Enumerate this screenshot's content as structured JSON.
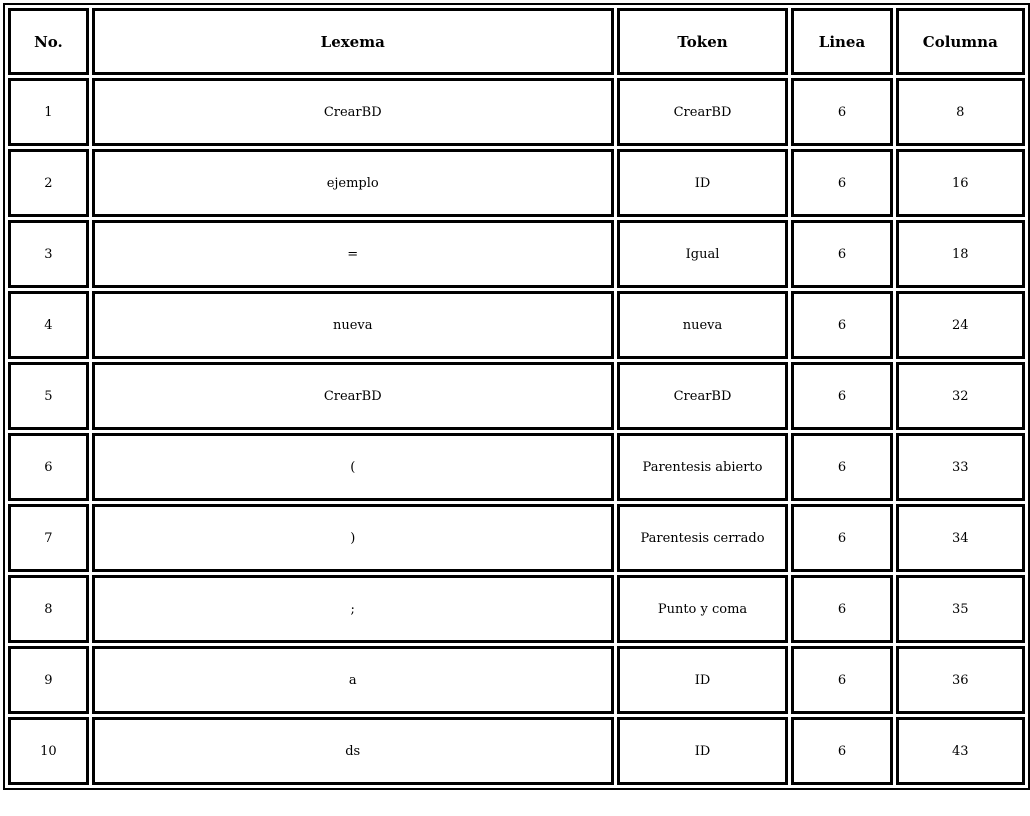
{
  "table": {
    "headers": {
      "no": "No.",
      "lexema": "Lexema",
      "token": "Token",
      "linea": "Linea",
      "columna": "Columna"
    },
    "rows": [
      {
        "no": "1",
        "lexema": "CrearBD",
        "token": "CrearBD",
        "linea": "6",
        "columna": "8"
      },
      {
        "no": "2",
        "lexema": "ejemplo",
        "token": "ID",
        "linea": "6",
        "columna": "16"
      },
      {
        "no": "3",
        "lexema": "=",
        "token": "Igual",
        "linea": "6",
        "columna": "18"
      },
      {
        "no": "4",
        "lexema": "nueva",
        "token": "nueva",
        "linea": "6",
        "columna": "24"
      },
      {
        "no": "5",
        "lexema": "CrearBD",
        "token": "CrearBD",
        "linea": "6",
        "columna": "32"
      },
      {
        "no": "6",
        "lexema": "(",
        "token": "Parentesis abierto",
        "linea": "6",
        "columna": "33"
      },
      {
        "no": "7",
        "lexema": ")",
        "token": "Parentesis cerrado",
        "linea": "6",
        "columna": "34"
      },
      {
        "no": "8",
        "lexema": ";",
        "token": "Punto y coma",
        "linea": "6",
        "columna": "35"
      },
      {
        "no": "9",
        "lexema": "a",
        "token": "ID",
        "linea": "6",
        "columna": "36"
      },
      {
        "no": "10",
        "lexema": "ds",
        "token": "ID",
        "linea": "6",
        "columna": "43"
      }
    ]
  }
}
